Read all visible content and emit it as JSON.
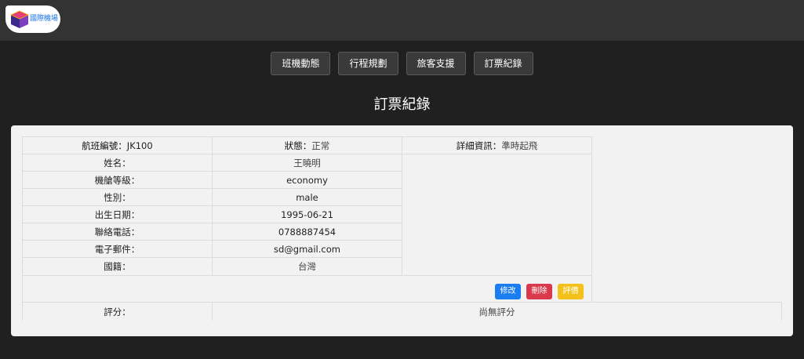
{
  "header": {
    "logo_text": "國際機場"
  },
  "nav": {
    "items": [
      {
        "label": "班機動態"
      },
      {
        "label": "行程規劃"
      },
      {
        "label": "旅客支援"
      },
      {
        "label": "訂票紀錄"
      }
    ]
  },
  "page": {
    "title": "訂票紀錄"
  },
  "booking": {
    "flight_label": "航班編號：",
    "flight_value": "JK100",
    "status_label": "狀態：",
    "status_value": "正常",
    "detail_label": "詳細資訊：",
    "detail_value": "準時起飛",
    "fields": [
      {
        "label": "姓名：",
        "value": "王曉明"
      },
      {
        "label": "機艙等級：",
        "value": "economy"
      },
      {
        "label": "性別：",
        "value": "male"
      },
      {
        "label": "出生日期：",
        "value": "1995-06-21"
      },
      {
        "label": "聯絡電話：",
        "value": "0788887454"
      },
      {
        "label": "電子郵件：",
        "value": "sd@gmail.com"
      },
      {
        "label": "國籍：",
        "value": "台灣"
      }
    ],
    "actions": {
      "edit_label": "修改",
      "delete_label": "刪除",
      "review_label": "評價"
    },
    "rating_label": "評分：",
    "rating_value": "尚無評分"
  },
  "colors": {
    "header_bg": "#333333",
    "page_bg": "#202020",
    "card_bg": "#f2f2f2",
    "edit_button": "#1a7ef0",
    "delete_button": "#d9394a",
    "review_button": "#f4c01a"
  }
}
